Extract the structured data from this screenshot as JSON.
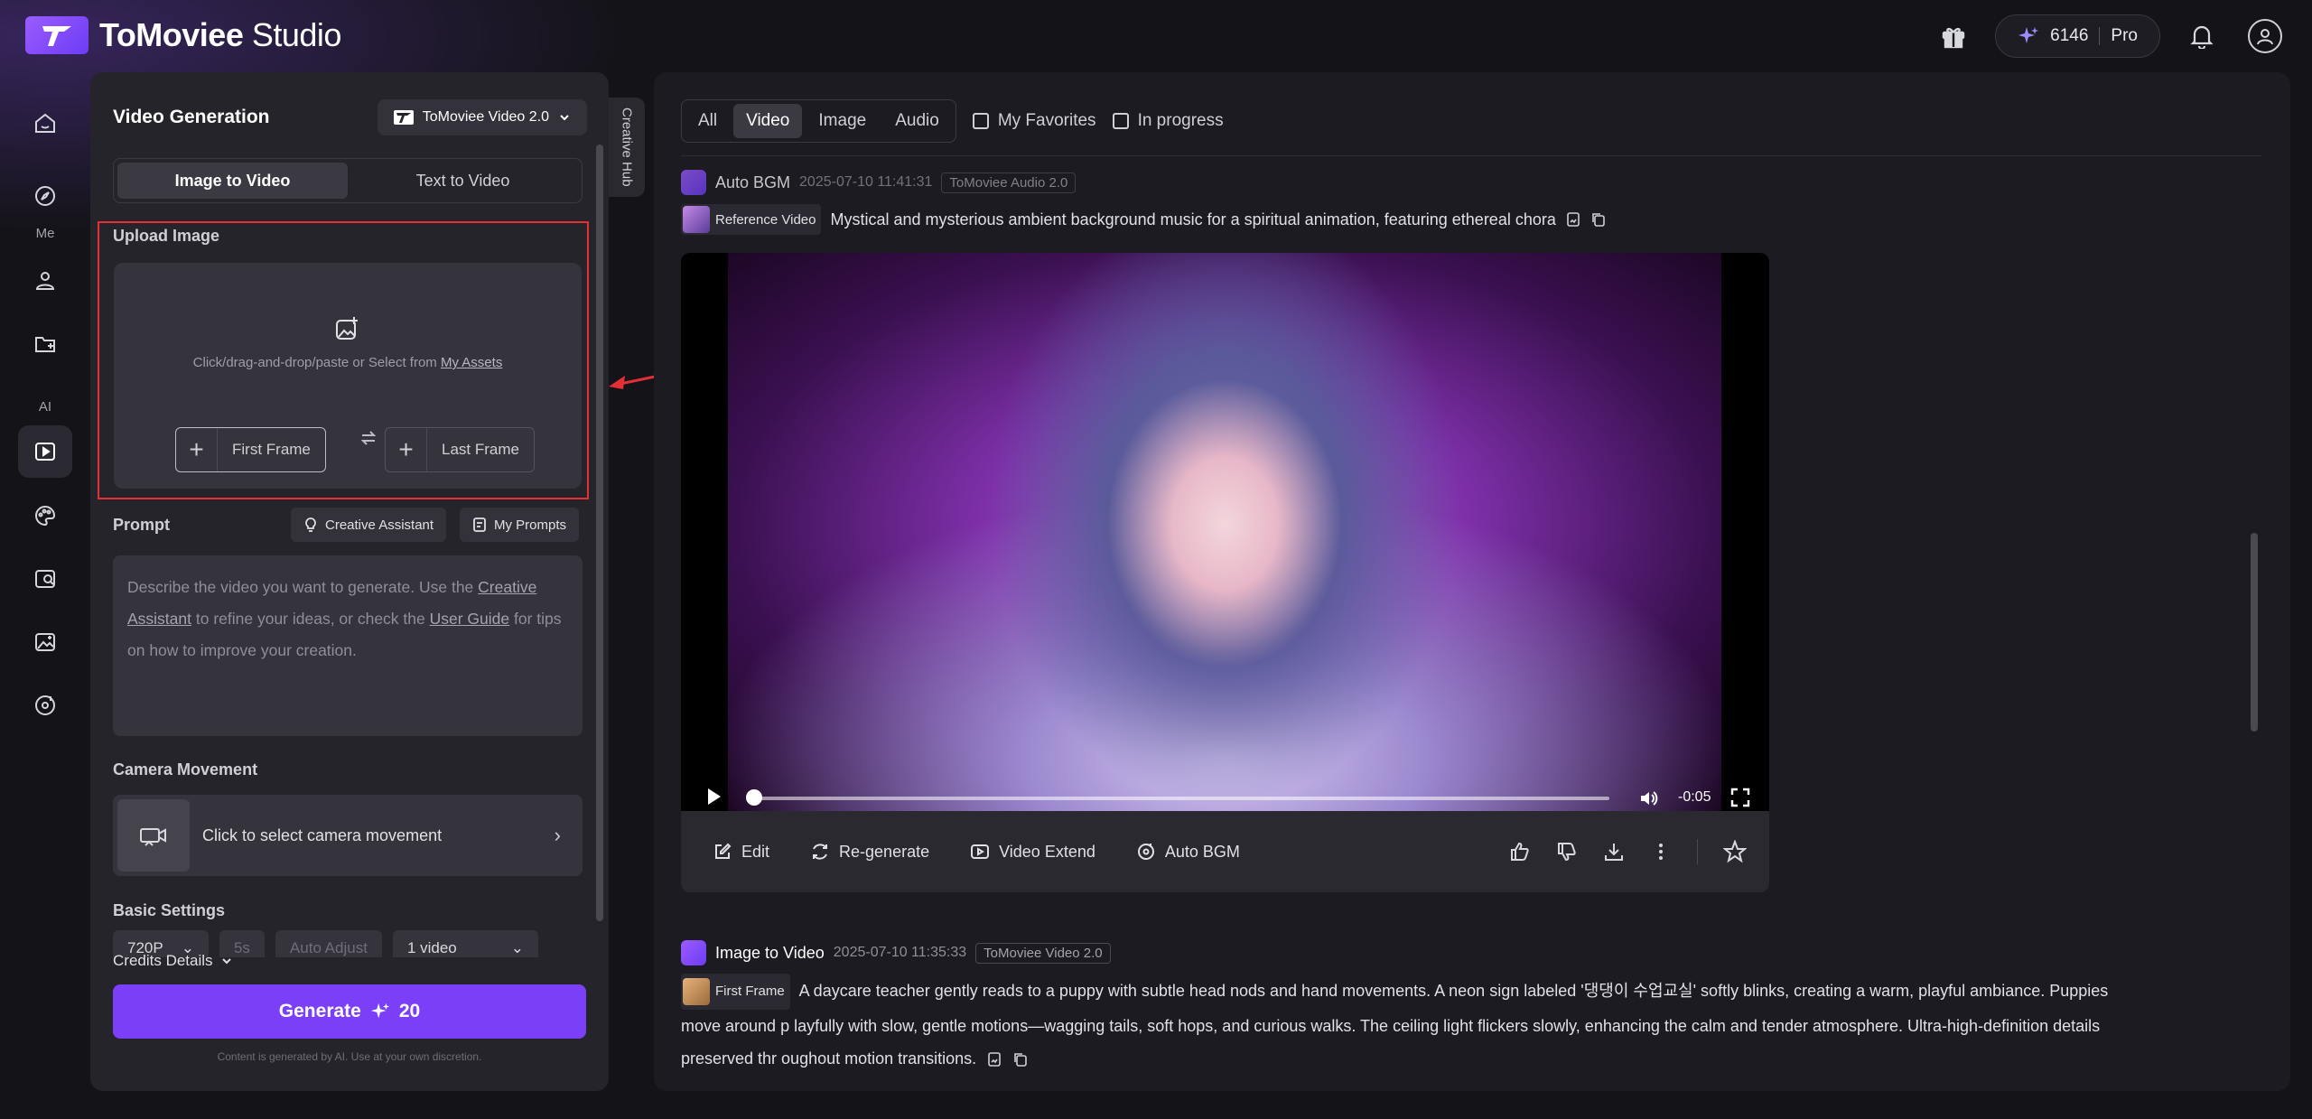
{
  "app": {
    "logo_brand": "ToMoviee",
    "logo_suffix": "Studio",
    "credits": "6146",
    "plan": "Pro"
  },
  "rail": {
    "me_label": "Me",
    "ai_label": "AI"
  },
  "panel": {
    "title": "Video Generation",
    "model": "ToMoviee Video 2.0",
    "tabs": [
      "Image to Video",
      "Text to Video"
    ],
    "creative_hub": "Creative Hub",
    "upload": {
      "label": "Upload Image",
      "hint_prefix": "Click/drag-and-drop/paste or Select from ",
      "hint_link": "My Assets",
      "first_frame": "First Frame",
      "last_frame": "Last Frame"
    },
    "prompt": {
      "label": "Prompt",
      "creative_assistant": "Creative Assistant",
      "my_prompts": "My Prompts",
      "placeholder_1": "Describe the video you want to generate. Use the ",
      "placeholder_link1": "Creative Assistant",
      "placeholder_2": " to refine your ideas, or check the ",
      "placeholder_link2": "User Guide",
      "placeholder_3": " for tips on how to improve your creation."
    },
    "camera": {
      "label": "Camera Movement",
      "button": "Click to select camera movement"
    },
    "basic": {
      "label": "Basic Settings",
      "resolution": "720P",
      "duration": "5s",
      "auto_adjust": "Auto Adjust",
      "count": "1 video"
    },
    "credits_details": "Credits Details",
    "generate_label": "Generate",
    "generate_cost": "20",
    "disclaimer": "Content is generated by AI. Use at your own discretion."
  },
  "main": {
    "filters": [
      "All",
      "Video",
      "Image",
      "Audio"
    ],
    "active_filter": "Video",
    "my_favorites": "My Favorites",
    "in_progress": "In progress",
    "item1": {
      "title": "Auto BGM",
      "timestamp": "2025-07-10 11:41:31",
      "model_tag": "ToMoviee Audio 2.0",
      "ref_label": "Reference Video",
      "description": "Mystical and mysterious ambient background music for a spiritual animation, featuring ethereal chora",
      "time_remaining": "-0:05",
      "progress": 0,
      "actions": [
        "Edit",
        "Re-generate",
        "Video Extend",
        "Auto BGM"
      ]
    },
    "item2": {
      "title": "Image to Video",
      "timestamp": "2025-07-10 11:35:33",
      "model_tag": "ToMoviee Video 2.0",
      "ref_label": "First Frame",
      "description": "A daycare teacher gently reads to a puppy with subtle head nods and hand movements. A neon sign labeled '댕댕이 수업교실' softly blinks, creating a warm, playful ambiance. Puppies move around p layfully with slow, gentle motions—wagging tails, soft hops, and curious walks. The ceiling light flickers slowly, enhancing the calm and tender atmosphere. Ultra-high-definition details preserved thr oughout motion transitions."
    }
  },
  "colors": {
    "accent": "#7b3ff7",
    "highlight_border": "#e52f36",
    "background": "#141318",
    "panel": "#25242b"
  }
}
